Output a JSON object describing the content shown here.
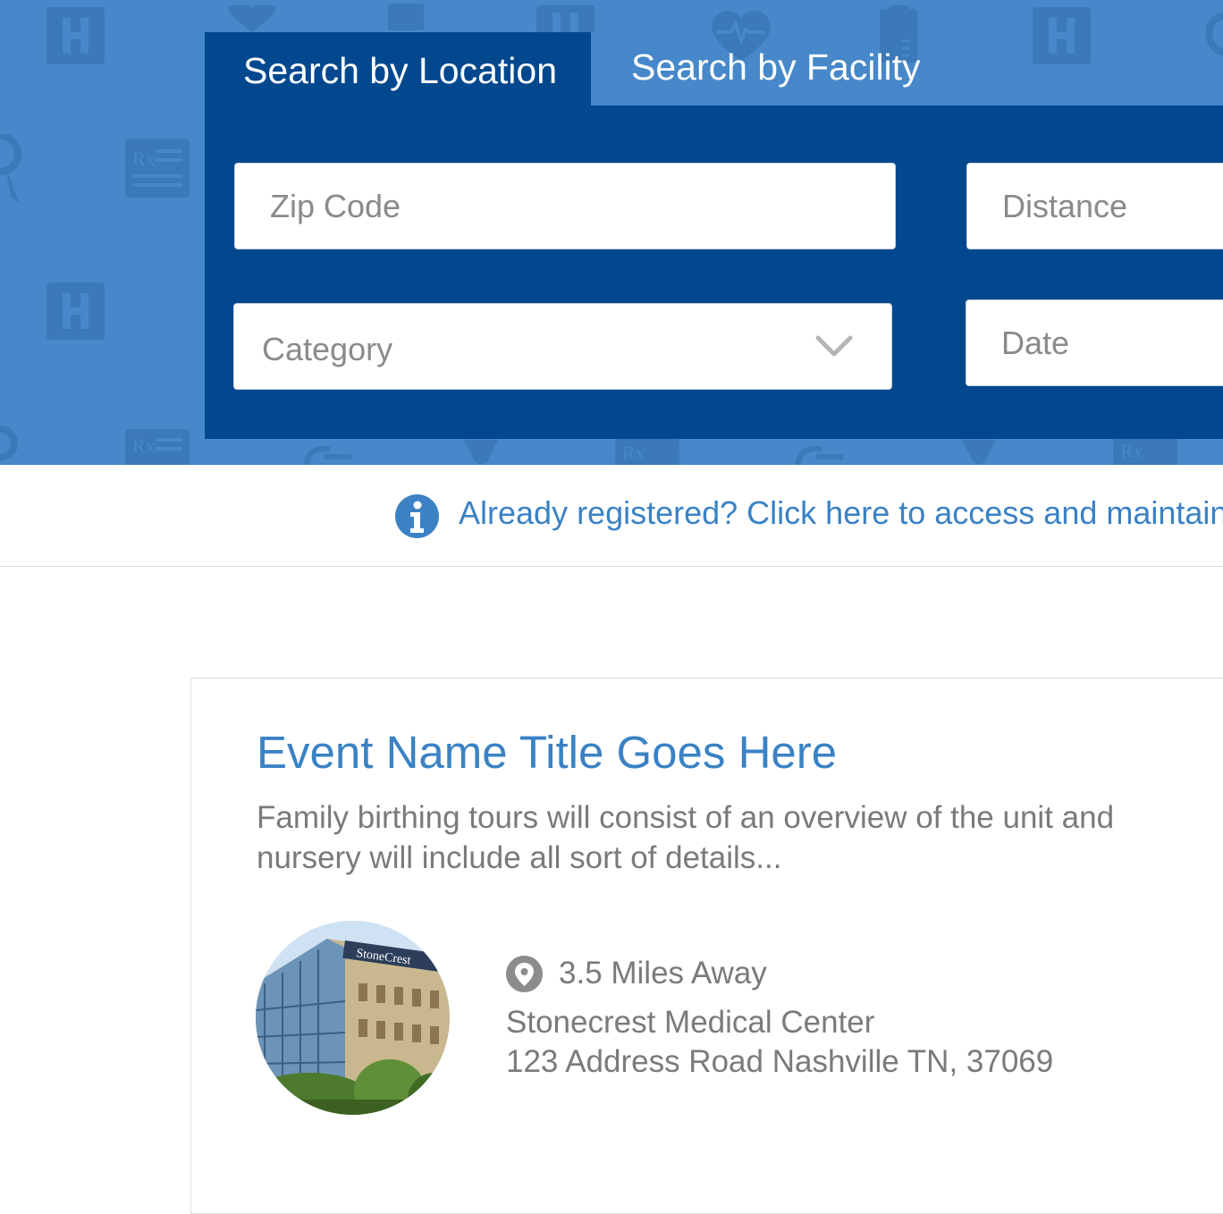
{
  "search": {
    "tabs": [
      {
        "label": "Search by Location",
        "active": true
      },
      {
        "label": "Search by Facility",
        "active": false
      }
    ],
    "zip_placeholder": "Zip Code",
    "distance_placeholder": "Distance",
    "category_placeholder": "Category",
    "date_placeholder": "Date"
  },
  "registration_notice": {
    "link_text": "Already registered? Click here to access and maintain"
  },
  "event": {
    "title": "Event Name Title Goes Here",
    "description": "Family birthing tours will consist of an overview of the unit and nursery will include all sort of details...",
    "distance": "3.5 Miles Away",
    "facility_name": "Stonecrest Medical Center",
    "facility_address": "123 Address Road Nashville TN, 37069",
    "photo_sign_text": "StoneCrest"
  },
  "colors": {
    "hero_background": "#4688c9",
    "panel_navy": "#02488f",
    "link_blue": "#3a82c4",
    "muted_text": "#7a7a7a"
  },
  "icons": {
    "info": "info-icon",
    "location": "map-pin-icon",
    "dropdown": "chevron-down-icon",
    "background_pattern": [
      "hospital-icon",
      "heart-pulse-icon",
      "prescription-icon",
      "medical-chart-icon",
      "ribbon-icon",
      "stethoscope-icon"
    ]
  }
}
